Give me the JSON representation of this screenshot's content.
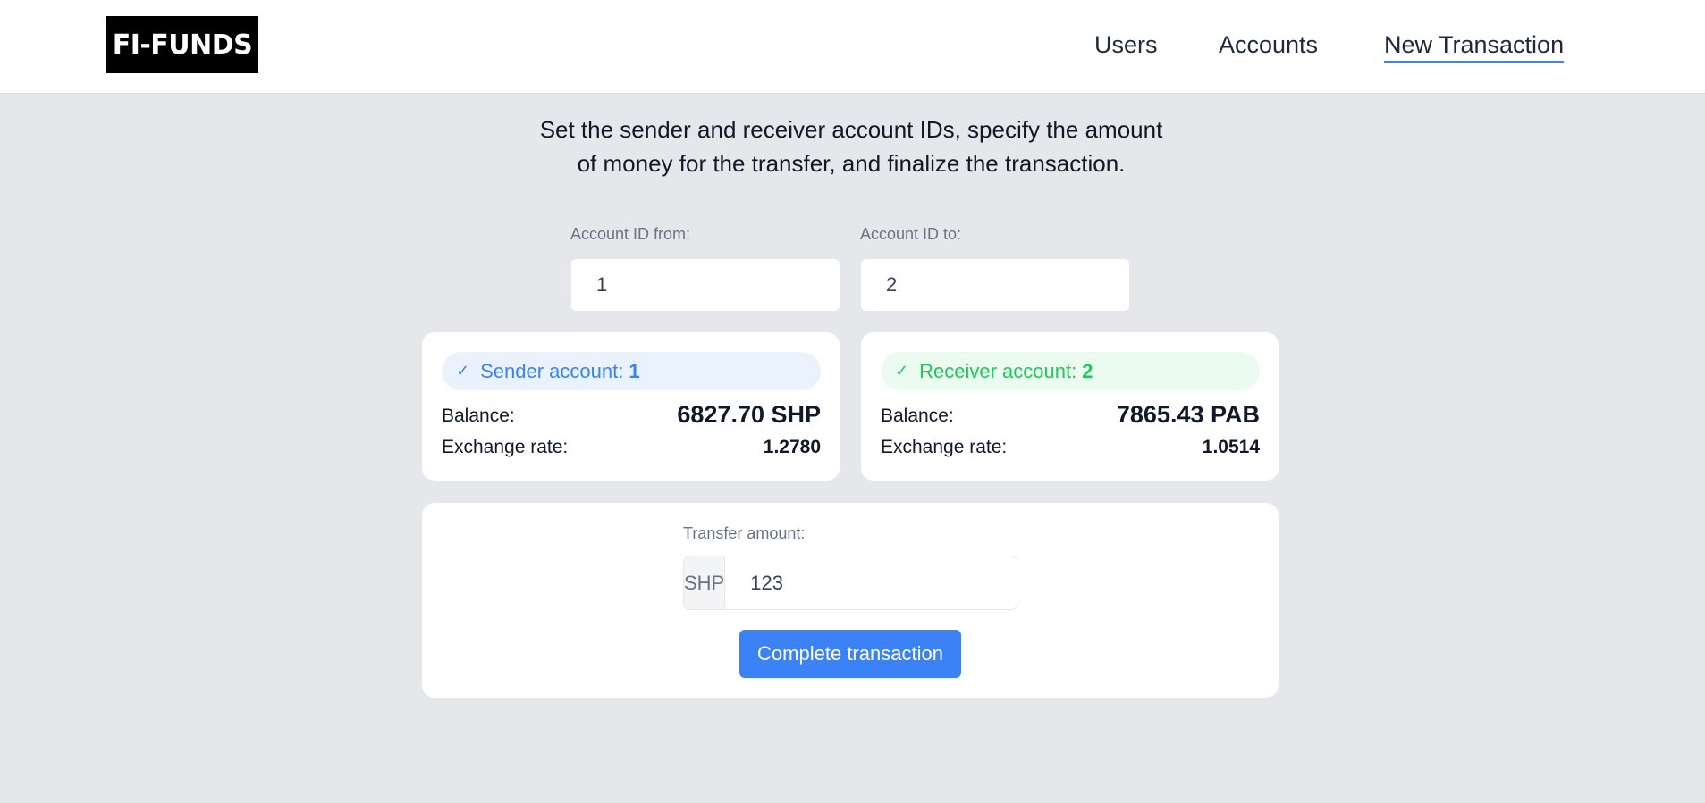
{
  "header": {
    "logo": "FI-FUNDS",
    "nav": {
      "users": "Users",
      "accounts": "Accounts",
      "new_transaction": "New Transaction"
    },
    "active_nav": "New Transaction",
    "accent_color": "#3b82f6"
  },
  "instructions": "Set the sender and receiver account IDs, specify the amount of money for the transfer, and finalize the transaction.",
  "form": {
    "from_label": "Account ID from:",
    "from_value": "1",
    "to_label": "Account ID to:",
    "to_value": "2"
  },
  "sender_card": {
    "badge_icon": "check-icon",
    "badge_label": "Sender account:",
    "account_id": "1",
    "balance_label": "Balance:",
    "balance": "6827.70 SHP",
    "rate_label": "Exchange rate:",
    "rate": "1.2780",
    "color": "#3b82f6"
  },
  "receiver_card": {
    "badge_icon": "check-icon",
    "badge_label": "Receiver account:",
    "account_id": "2",
    "balance_label": "Balance:",
    "balance": "7865.43 PAB",
    "rate_label": "Exchange rate:",
    "rate": "1.0514",
    "color": "#22c55e"
  },
  "transfer": {
    "label": "Transfer amount:",
    "currency": "SHP",
    "amount": "123",
    "submit_label": "Complete transaction"
  }
}
